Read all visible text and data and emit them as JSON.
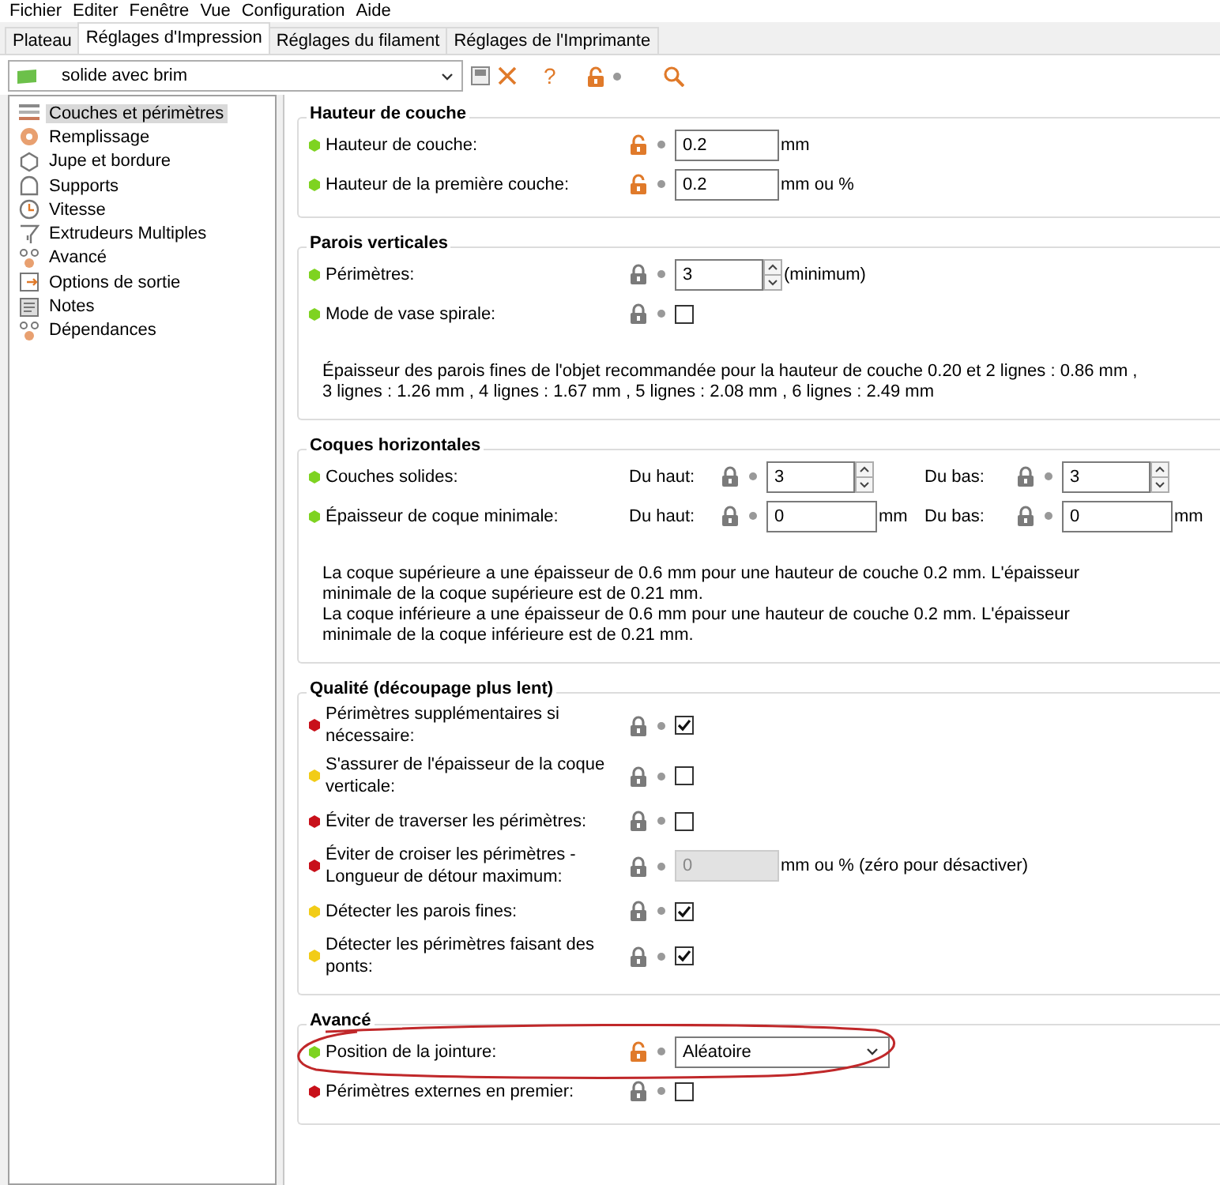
{
  "menu": [
    "Fichier",
    "Editer",
    "Fenêtre",
    "Vue",
    "Configuration",
    "Aide"
  ],
  "tabs": [
    {
      "label": "Plateau",
      "selected": false
    },
    {
      "label": "Réglages d'Impression",
      "selected": true
    },
    {
      "label": "Réglages du filament",
      "selected": false
    },
    {
      "label": "Réglages de l'Imprimante",
      "selected": false
    }
  ],
  "toolbar": {
    "preset": "solide avec brim",
    "help": "?",
    "locked": false
  },
  "sidebar": {
    "items": [
      {
        "label": "Couches et périmètres",
        "selected": true
      },
      {
        "label": "Remplissage",
        "selected": false
      },
      {
        "label": "Jupe et bordure",
        "selected": false
      },
      {
        "label": "Supports",
        "selected": false
      },
      {
        "label": "Vitesse",
        "selected": false
      },
      {
        "label": "Extrudeurs Multiples",
        "selected": false
      },
      {
        "label": "Avancé",
        "selected": false
      },
      {
        "label": "Options de sortie",
        "selected": false
      },
      {
        "label": "Notes",
        "selected": false
      },
      {
        "label": "Dépendances",
        "selected": false
      }
    ]
  },
  "sections": [
    {
      "title": "Hauteur de couche",
      "rows": [
        {
          "label": "Hauteur de couche:",
          "color": "#7ed321",
          "circled": false,
          "fields": [
            {
              "locked": false,
              "kind": "text",
              "value": "0.2",
              "unit": "mm",
              "disabled": false
            }
          ]
        },
        {
          "label": "Hauteur de la première couche:",
          "color": "#7ed321",
          "circled": false,
          "fields": [
            {
              "locked": false,
              "kind": "text",
              "value": "0.2",
              "unit": "mm ou %",
              "disabled": false
            }
          ]
        }
      ]
    },
    {
      "title": "Parois verticales",
      "rows": [
        {
          "label": "Périmètres:",
          "color": "#7ed321",
          "circled": false,
          "fields": [
            {
              "locked": true,
              "kind": "spin",
              "value": "3",
              "unit": "(minimum)"
            }
          ]
        },
        {
          "label": "Mode de vase spirale:",
          "color": "#7ed321",
          "circled": false,
          "fields": [
            {
              "locked": true,
              "kind": "check",
              "checked": false
            }
          ]
        }
      ],
      "notes": [
        "Épaisseur des parois fines de l'objet recommandée pour la hauteur de couche 0.20 et 2 lignes : 0.86 mm , 3 lignes : 1.26 mm , 4 lignes : 1.67 mm , 5 lignes : 2.08 mm , 6 lignes : 2.49 mm"
      ]
    },
    {
      "title": "Coques horizontales",
      "rows": [
        {
          "label": "Couches solides:",
          "color": "#7ed321",
          "circled": false,
          "fields": [
            {
              "prefix": "Du haut:",
              "locked": true,
              "kind": "spin",
              "value": "3"
            },
            {
              "prefix": "Du bas:",
              "locked": true,
              "kind": "spin",
              "value": "3"
            }
          ]
        },
        {
          "label": "Épaisseur de coque minimale:",
          "color": "#7ed321",
          "circled": false,
          "fields": [
            {
              "prefix": "Du haut:",
              "locked": true,
              "kind": "text",
              "value": "0",
              "unit": "mm",
              "disabled": false
            },
            {
              "prefix": "Du bas:",
              "locked": true,
              "kind": "text",
              "value": "0",
              "unit": "mm",
              "disabled": false
            }
          ]
        }
      ],
      "notes": [
        "La coque supérieure a une épaisseur de 0.6 mm pour une hauteur de couche 0.2 mm. L'épaisseur minimale de la coque supérieure est de 0.21 mm.",
        "La coque inférieure a une épaisseur de 0.6 mm pour une hauteur de couche 0.2 mm. L'épaisseur minimale de la coque inférieure est de 0.21 mm."
      ]
    },
    {
      "title": "Qualité (découpage plus lent)",
      "rows": [
        {
          "label": "Périmètres supplémentaires si nécessaire:",
          "color": "#c8101a",
          "circled": false,
          "fields": [
            {
              "locked": true,
              "kind": "check",
              "checked": true
            }
          ]
        },
        {
          "label": "S'assurer de l'épaisseur de la coque verticale:",
          "color": "#f2cc17",
          "circled": false,
          "fields": [
            {
              "locked": true,
              "kind": "check",
              "checked": false
            }
          ]
        },
        {
          "label": "Éviter de traverser les périmètres:",
          "color": "#c8101a",
          "circled": false,
          "fields": [
            {
              "locked": true,
              "kind": "check",
              "checked": false
            }
          ]
        },
        {
          "label": "Éviter de croiser les périmètres - Longueur de détour maximum:",
          "color": "#c8101a",
          "circled": false,
          "fields": [
            {
              "locked": true,
              "kind": "text",
              "value": "0",
              "unit": "mm ou % (zéro pour désactiver)",
              "disabled": true
            }
          ]
        },
        {
          "label": "Détecter les parois fines:",
          "color": "#f2cc17",
          "circled": false,
          "fields": [
            {
              "locked": true,
              "kind": "check",
              "checked": true
            }
          ]
        },
        {
          "label": "Détecter les périmètres faisant des ponts:",
          "color": "#f2cc17",
          "circled": false,
          "fields": [
            {
              "locked": true,
              "kind": "check",
              "checked": true
            }
          ]
        }
      ]
    },
    {
      "title": "Avancé",
      "rows": [
        {
          "label": "Position de la jointure:",
          "color": "#7ed321",
          "circled": true,
          "fields": [
            {
              "locked": false,
              "kind": "select",
              "value": "Aléatoire"
            }
          ]
        },
        {
          "label": "Périmètres externes en premier:",
          "color": "#c8101a",
          "circled": false,
          "fields": [
            {
              "locked": true,
              "kind": "check",
              "checked": false
            }
          ]
        }
      ]
    }
  ]
}
